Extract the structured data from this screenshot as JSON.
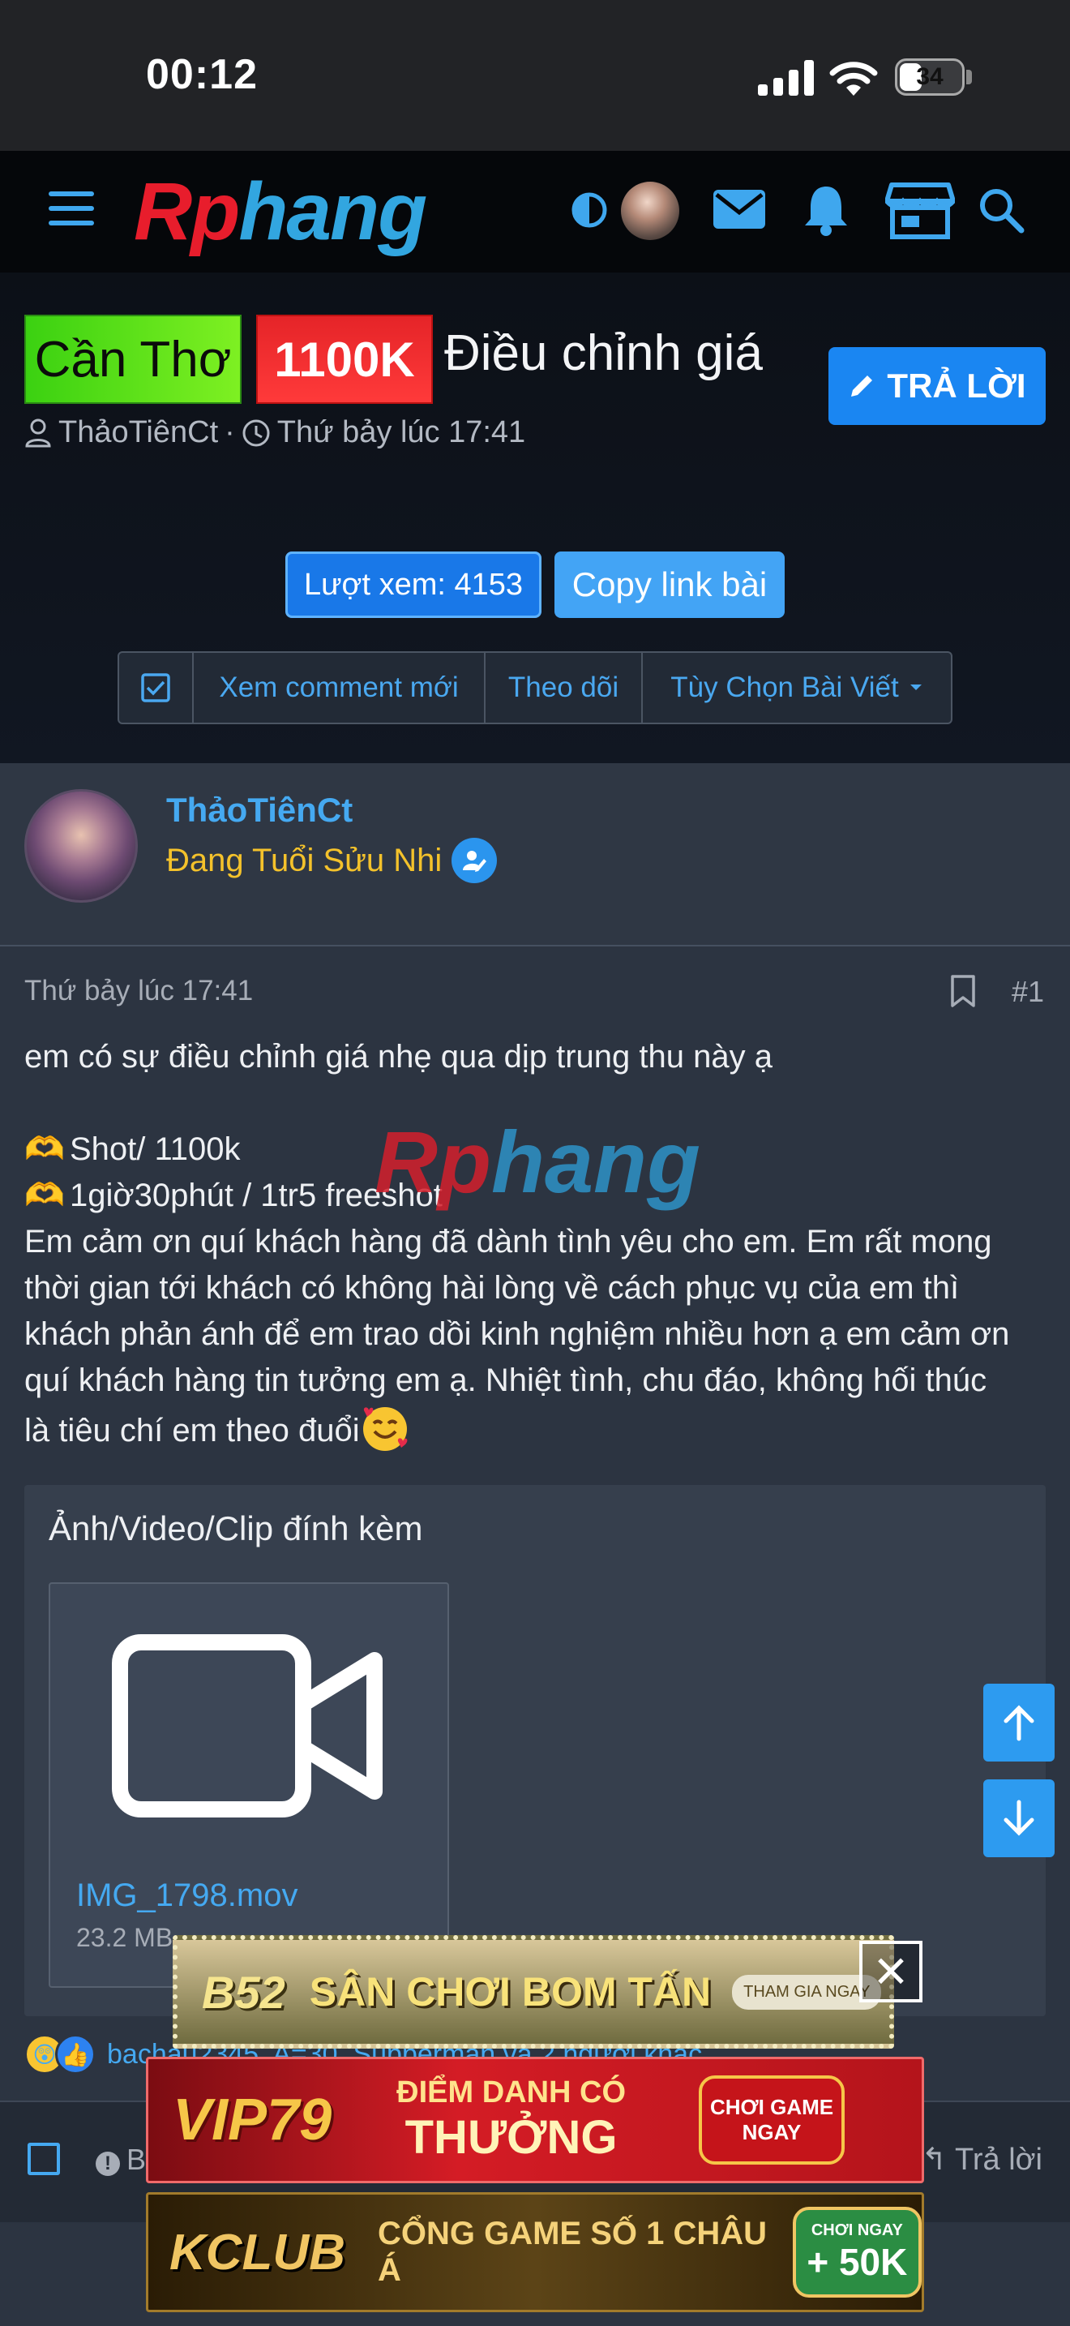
{
  "status_bar": {
    "time": "00:12",
    "battery": "34"
  },
  "header": {
    "logo_part1": "Rp",
    "logo_part2": "hang"
  },
  "thread": {
    "prefix_location": "Cần Thơ",
    "prefix_price": "1100K",
    "title": "Điều chỉnh giá",
    "reply_button": "TRẢ LỜI",
    "author": "ThảoTiênCt",
    "separator": "·",
    "date": "Thứ bảy lúc 17:41",
    "views_label": "Lượt xem: 4153",
    "copy_link_label": "Copy link bài",
    "toolbar": {
      "new_comments": "Xem comment mới",
      "follow": "Theo dõi",
      "options": "Tùy Chọn Bài Viết"
    }
  },
  "post": {
    "author_name": "ThảoTiênCt",
    "author_title": "Đang Tuổi Sửu Nhi",
    "date": "Thứ bảy lúc 17:41",
    "number": "#1",
    "lines": {
      "l1": "em có sự điều chỉnh giá nhẹ qua dịp trung thu này ạ",
      "l2": "Shot/ 1100k",
      "l3": "1giờ30phút / 1tr5 freeshot",
      "l4": "Em cảm ơn quí khách hàng đã dành tình yêu cho em. Em rất mong",
      "l5": "thời gian tới khách có không hài lòng về cách phục vụ của em thì",
      "l6": "khách phản ánh để em trao dồi kinh nghiệm nhiều hơn ạ em cảm ơn",
      "l7": "quí khách hàng tin tưởng em ạ. Nhiệt tình, chu đáo, không hối thúc",
      "l8": "là tiêu chí em theo đuổi"
    },
    "watermark_part1": "Rp",
    "watermark_part2": "hang",
    "attachments_title": "Ảnh/Video/Clip đính kèm",
    "attachment": {
      "name": "IMG_1798.mov",
      "size": "23.2 MB"
    },
    "reactions_text": "bachau2345, A=30, Supperman và 2 người khác",
    "footer": {
      "report": "Báo cáo",
      "reply": "Trả lời"
    }
  },
  "ads": {
    "ad1": {
      "brand": "B52",
      "slogan": "SÂN CHƠI BOM TẤN",
      "cta": "THAM GIA NGAY"
    },
    "ad2": {
      "brand": "VIP79",
      "slogan_top": "ĐIỂM DANH CÓ",
      "slogan_bottom": "THƯỞNG",
      "cta": "CHƠI GAME NGAY"
    },
    "ad3": {
      "brand": "KCLUB",
      "slogan": "CỔNG GAME SỐ 1 CHÂU Á",
      "cta_top": "CHƠI NGAY",
      "cta_bottom": "+ 50K"
    },
    "close": "✕"
  },
  "colors": {
    "accent": "#45a9f1",
    "button": "#1a86f2",
    "title_gold": "#f4c22b"
  }
}
